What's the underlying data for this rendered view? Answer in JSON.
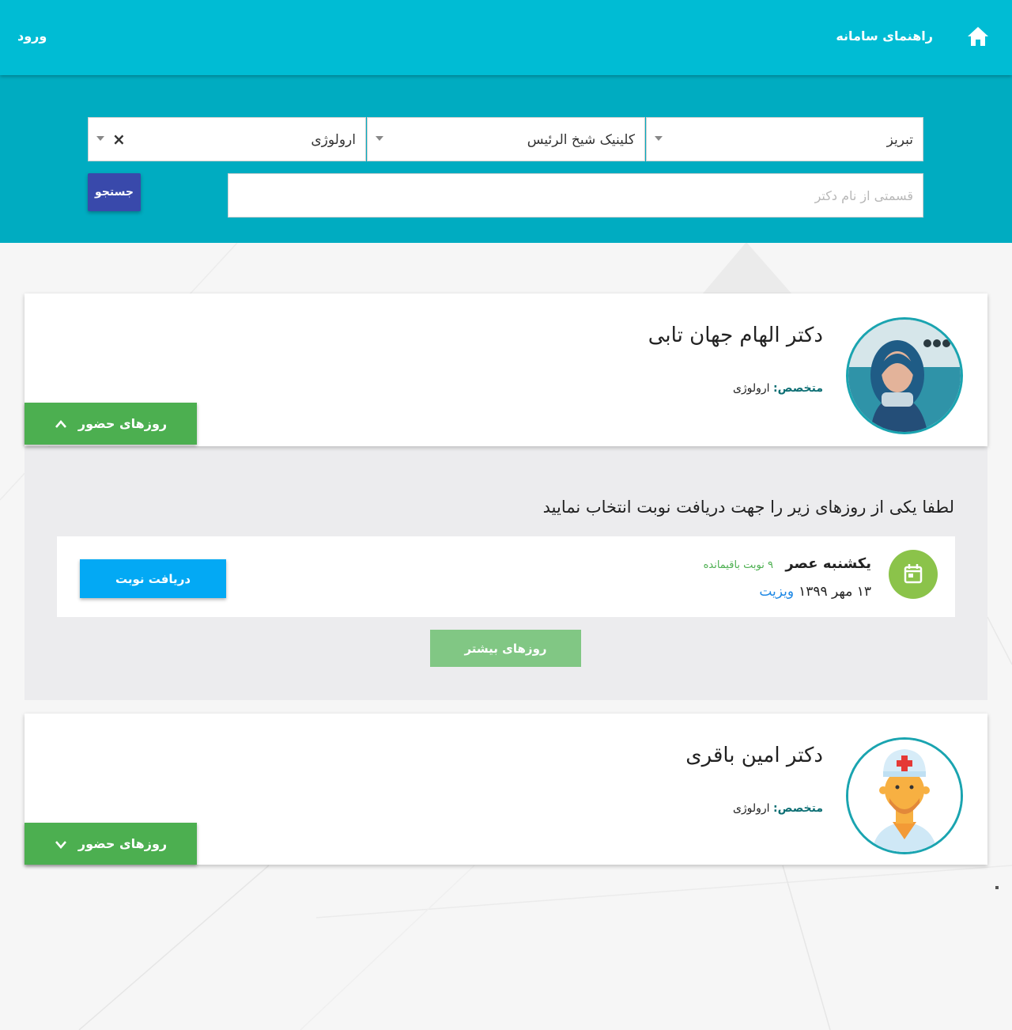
{
  "header": {
    "guide_label": "راهنمای سامانه",
    "login_label": "ورود",
    "home_icon": "home-icon"
  },
  "search": {
    "city_value": "تبریز",
    "clinic_value": "کلینیک شیخ الرئیس",
    "specialty_value": "ارولوژی",
    "clear_glyph": "×",
    "name_placeholder": "قسمتی از نام دکتر",
    "name_value": "",
    "search_label": "جستجو"
  },
  "doctors": [
    {
      "name": "دکتر الهام جهان تابی",
      "specialty_label": "متخصص:",
      "specialty": "ارولوژی",
      "days_button": "روزهای حضور",
      "expanded": true
    },
    {
      "name": "دکتر امین باقری",
      "specialty_label": "متخصص:",
      "specialty": "ارولوژی",
      "days_button": "روزهای حضور",
      "expanded": false
    }
  ],
  "schedule": {
    "prompt": "لطفا یکی از روزهای زیر را جهت دریافت نوبت انتخاب نمایید",
    "slots": [
      {
        "day": "یکشنبه عصر",
        "remaining": "۹ نوبت باقیمانده",
        "date": "۱۳ مهر ۱۳۹۹",
        "type": "ویزیت",
        "book_label": "دریافت نوبت"
      }
    ],
    "more_label": "روزهای بیشتر"
  },
  "colors": {
    "topbar": "#00bcd4",
    "search_band": "#00acc1",
    "search_button": "#3949ab",
    "days_button": "#4caf50",
    "book_button": "#03a9f4",
    "more_button": "#81c784",
    "calendar_badge": "#8bc34a"
  }
}
